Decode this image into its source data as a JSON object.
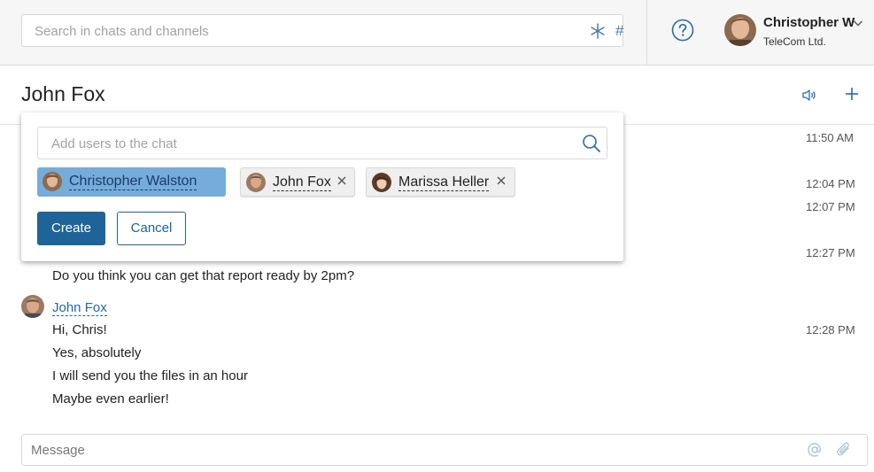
{
  "topbar": {
    "search_placeholder": "Search in chats and channels",
    "hash_symbol": "#",
    "user": {
      "name": "Christopher W",
      "company": "TeleCom Ltd."
    }
  },
  "chat": {
    "title": "John Fox",
    "timestamps": [
      "11:50 AM",
      "12:04 PM",
      "12:07 PM",
      "12:27 PM",
      "12:28 PM"
    ],
    "messages": [
      {
        "text": "Do you think you can get that report ready by 2pm?"
      }
    ],
    "group": {
      "sender": "John Fox",
      "lines": [
        "Hi, Chris!",
        "Yes, absolutely",
        "I will send you the files in an hour",
        "Maybe even earlier!"
      ]
    },
    "input_placeholder": "Message"
  },
  "popup": {
    "search_placeholder": "Add users to the chat",
    "chips": [
      {
        "name": "Christopher Walston",
        "selected": true
      },
      {
        "name": "John Fox",
        "selected": false
      },
      {
        "name": "Marissa Heller",
        "selected": false
      }
    ],
    "create_label": "Create",
    "cancel_label": "Cancel"
  },
  "colors": {
    "accent": "#1f6498",
    "link": "#2067b0",
    "chip_selected": "#75acdb",
    "icon_blue": "#4a7bb0"
  }
}
